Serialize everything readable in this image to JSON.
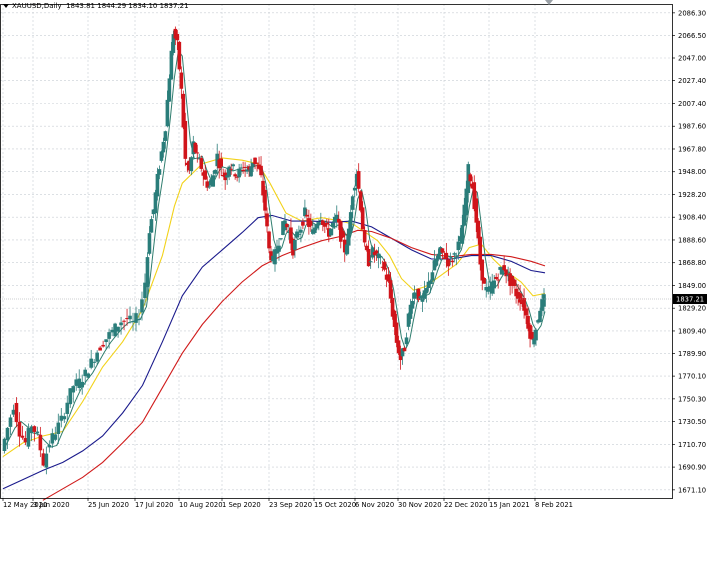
{
  "header": {
    "symbol": "XAUUSD,Daily",
    "ohlc": "1843.81 1844.29 1834.10 1837.21"
  },
  "colors": {
    "up_candle": "#2a7d7a",
    "down_candle": "#d0141a",
    "ma_fast": "#2f7d6e",
    "ma_yellow": "#f2d21a",
    "ma_blue": "#1a1a8c",
    "ma_red": "#d01b1b",
    "grid": "#c8cdd3",
    "current_price_bg": "#000000"
  },
  "chart_data": {
    "type": "candlestick",
    "symbol": "XAUUSD",
    "timeframe": "Daily",
    "current_price": 1837.21,
    "ylim": [
      1664.0,
      2094.0
    ],
    "y_ticks": [
      "2086.30",
      "2066.50",
      "2047.00",
      "2027.40",
      "2007.40",
      "1987.60",
      "1967.80",
      "1948.00",
      "1928.20",
      "1908.40",
      "1888.60",
      "1868.80",
      "1849.00",
      "1829.20",
      "1809.40",
      "1789.90",
      "1770.10",
      "1750.30",
      "1730.50",
      "1710.70",
      "1690.90",
      "1671.10"
    ],
    "x_ticks": [
      "12 May 2020",
      "3 Jun 2020",
      "25 Jun 2020",
      "17 Jul 2020",
      "10 Aug 2020",
      "1 Sep 2020",
      "23 Sep 2020",
      "15 Oct 2020",
      "6 Nov 2020",
      "30 Nov 2020",
      "22 Dec 2020",
      "15 Jan 2021",
      "8 Feb 2021"
    ],
    "grid": true,
    "price_path": [
      [
        0,
        1705
      ],
      [
        6,
        1725
      ],
      [
        12,
        1745
      ],
      [
        18,
        1722
      ],
      [
        24,
        1712
      ],
      [
        30,
        1728
      ],
      [
        36,
        1718
      ],
      [
        42,
        1695
      ],
      [
        48,
        1712
      ],
      [
        54,
        1722
      ],
      [
        60,
        1732
      ],
      [
        66,
        1748
      ],
      [
        72,
        1762
      ],
      [
        78,
        1765
      ],
      [
        84,
        1772
      ],
      [
        90,
        1782
      ],
      [
        96,
        1792
      ],
      [
        102,
        1800
      ],
      [
        108,
        1806
      ],
      [
        114,
        1812
      ],
      [
        120,
        1818
      ],
      [
        126,
        1820
      ],
      [
        132,
        1816
      ],
      [
        138,
        1824
      ],
      [
        144,
        1852
      ],
      [
        148,
        1898
      ],
      [
        152,
        1915
      ],
      [
        156,
        1942
      ],
      [
        160,
        1965
      ],
      [
        164,
        1988
      ],
      [
        168,
        2032
      ],
      [
        172,
        2070
      ],
      [
        176,
        2058
      ],
      [
        180,
        2018
      ],
      [
        184,
        1958
      ],
      [
        188,
        1948
      ],
      [
        192,
        1972
      ],
      [
        196,
        1960
      ],
      [
        200,
        1952
      ],
      [
        204,
        1940
      ],
      [
        208,
        1935
      ],
      [
        212,
        1945
      ],
      [
        216,
        1962
      ],
      [
        220,
        1950
      ],
      [
        224,
        1942
      ],
      [
        228,
        1955
      ],
      [
        232,
        1950
      ],
      [
        236,
        1945
      ],
      [
        240,
        1950
      ],
      [
        244,
        1952
      ],
      [
        248,
        1948
      ],
      [
        252,
        1958
      ],
      [
        256,
        1955
      ],
      [
        260,
        1942
      ],
      [
        264,
        1915
      ],
      [
        268,
        1880
      ],
      [
        272,
        1870
      ],
      [
        276,
        1882
      ],
      [
        280,
        1895
      ],
      [
        284,
        1905
      ],
      [
        288,
        1895
      ],
      [
        292,
        1880
      ],
      [
        296,
        1892
      ],
      [
        300,
        1900
      ],
      [
        304,
        1912
      ],
      [
        308,
        1902
      ],
      [
        312,
        1895
      ],
      [
        316,
        1905
      ],
      [
        320,
        1910
      ],
      [
        324,
        1900
      ],
      [
        328,
        1895
      ],
      [
        332,
        1902
      ],
      [
        336,
        1908
      ],
      [
        340,
        1892
      ],
      [
        344,
        1880
      ],
      [
        348,
        1895
      ],
      [
        352,
        1930
      ],
      [
        356,
        1948
      ],
      [
        360,
        1918
      ],
      [
        364,
        1882
      ],
      [
        368,
        1870
      ],
      [
        372,
        1878
      ],
      [
        376,
        1875
      ],
      [
        380,
        1870
      ],
      [
        384,
        1862
      ],
      [
        388,
        1850
      ],
      [
        392,
        1825
      ],
      [
        396,
        1800
      ],
      [
        400,
        1785
      ],
      [
        404,
        1795
      ],
      [
        408,
        1822
      ],
      [
        412,
        1840
      ],
      [
        416,
        1845
      ],
      [
        420,
        1835
      ],
      [
        424,
        1840
      ],
      [
        428,
        1850
      ],
      [
        432,
        1862
      ],
      [
        436,
        1872
      ],
      [
        440,
        1878
      ],
      [
        444,
        1875
      ],
      [
        448,
        1870
      ],
      [
        452,
        1872
      ],
      [
        456,
        1880
      ],
      [
        460,
        1888
      ],
      [
        464,
        1915
      ],
      [
        468,
        1950
      ],
      [
        472,
        1935
      ],
      [
        476,
        1905
      ],
      [
        480,
        1868
      ],
      [
        484,
        1848
      ],
      [
        488,
        1842
      ],
      [
        492,
        1850
      ],
      [
        496,
        1855
      ],
      [
        500,
        1862
      ],
      [
        504,
        1865
      ],
      [
        508,
        1855
      ],
      [
        512,
        1850
      ],
      [
        516,
        1842
      ],
      [
        520,
        1838
      ],
      [
        524,
        1830
      ],
      [
        528,
        1815
      ],
      [
        532,
        1800
      ],
      [
        536,
        1812
      ],
      [
        540,
        1830
      ],
      [
        544,
        1837
      ]
    ],
    "series": [
      {
        "name": "",
        "color": "#f2d21a",
        "points": [
          [
            0,
            1700
          ],
          [
            20,
            1712
          ],
          [
            40,
            1718
          ],
          [
            60,
            1722
          ],
          [
            80,
            1748
          ],
          [
            100,
            1778
          ],
          [
            120,
            1800
          ],
          [
            140,
            1828
          ],
          [
            160,
            1875
          ],
          [
            172,
            1918
          ],
          [
            180,
            1938
          ],
          [
            200,
            1955
          ],
          [
            220,
            1960
          ],
          [
            240,
            1958
          ],
          [
            256,
            1955
          ],
          [
            268,
            1938
          ],
          [
            284,
            1912
          ],
          [
            300,
            1905
          ],
          [
            320,
            1908
          ],
          [
            340,
            1905
          ],
          [
            352,
            1902
          ],
          [
            364,
            1895
          ],
          [
            376,
            1888
          ],
          [
            388,
            1875
          ],
          [
            400,
            1855
          ],
          [
            412,
            1845
          ],
          [
            424,
            1848
          ],
          [
            440,
            1858
          ],
          [
            456,
            1868
          ],
          [
            468,
            1882
          ],
          [
            480,
            1885
          ],
          [
            492,
            1872
          ],
          [
            504,
            1862
          ],
          [
            520,
            1852
          ],
          [
            532,
            1840
          ],
          [
            544,
            1842
          ]
        ]
      },
      {
        "name": "",
        "color": "#1a1a8c",
        "points": [
          [
            0,
            1672
          ],
          [
            20,
            1680
          ],
          [
            40,
            1688
          ],
          [
            60,
            1695
          ],
          [
            80,
            1705
          ],
          [
            100,
            1718
          ],
          [
            120,
            1738
          ],
          [
            140,
            1762
          ],
          [
            160,
            1800
          ],
          [
            180,
            1840
          ],
          [
            200,
            1865
          ],
          [
            220,
            1880
          ],
          [
            240,
            1895
          ],
          [
            256,
            1908
          ],
          [
            270,
            1910
          ],
          [
            290,
            1905
          ],
          [
            310,
            1905
          ],
          [
            330,
            1904
          ],
          [
            350,
            1905
          ],
          [
            370,
            1900
          ],
          [
            390,
            1890
          ],
          [
            410,
            1880
          ],
          [
            430,
            1872
          ],
          [
            450,
            1872
          ],
          [
            470,
            1875
          ],
          [
            490,
            1875
          ],
          [
            510,
            1870
          ],
          [
            530,
            1862
          ],
          [
            544,
            1860
          ]
        ]
      },
      {
        "name": "",
        "color": "#d01b1b",
        "points": [
          [
            40,
            1662
          ],
          [
            60,
            1672
          ],
          [
            80,
            1682
          ],
          [
            100,
            1695
          ],
          [
            120,
            1712
          ],
          [
            140,
            1730
          ],
          [
            160,
            1760
          ],
          [
            180,
            1790
          ],
          [
            200,
            1815
          ],
          [
            220,
            1835
          ],
          [
            240,
            1852
          ],
          [
            260,
            1866
          ],
          [
            280,
            1875
          ],
          [
            300,
            1882
          ],
          [
            320,
            1888
          ],
          [
            340,
            1892
          ],
          [
            356,
            1897
          ],
          [
            370,
            1896
          ],
          [
            390,
            1890
          ],
          [
            410,
            1882
          ],
          [
            430,
            1876
          ],
          [
            450,
            1874
          ],
          [
            470,
            1876
          ],
          [
            490,
            1876
          ],
          [
            510,
            1874
          ],
          [
            530,
            1870
          ],
          [
            544,
            1866
          ]
        ]
      }
    ]
  }
}
